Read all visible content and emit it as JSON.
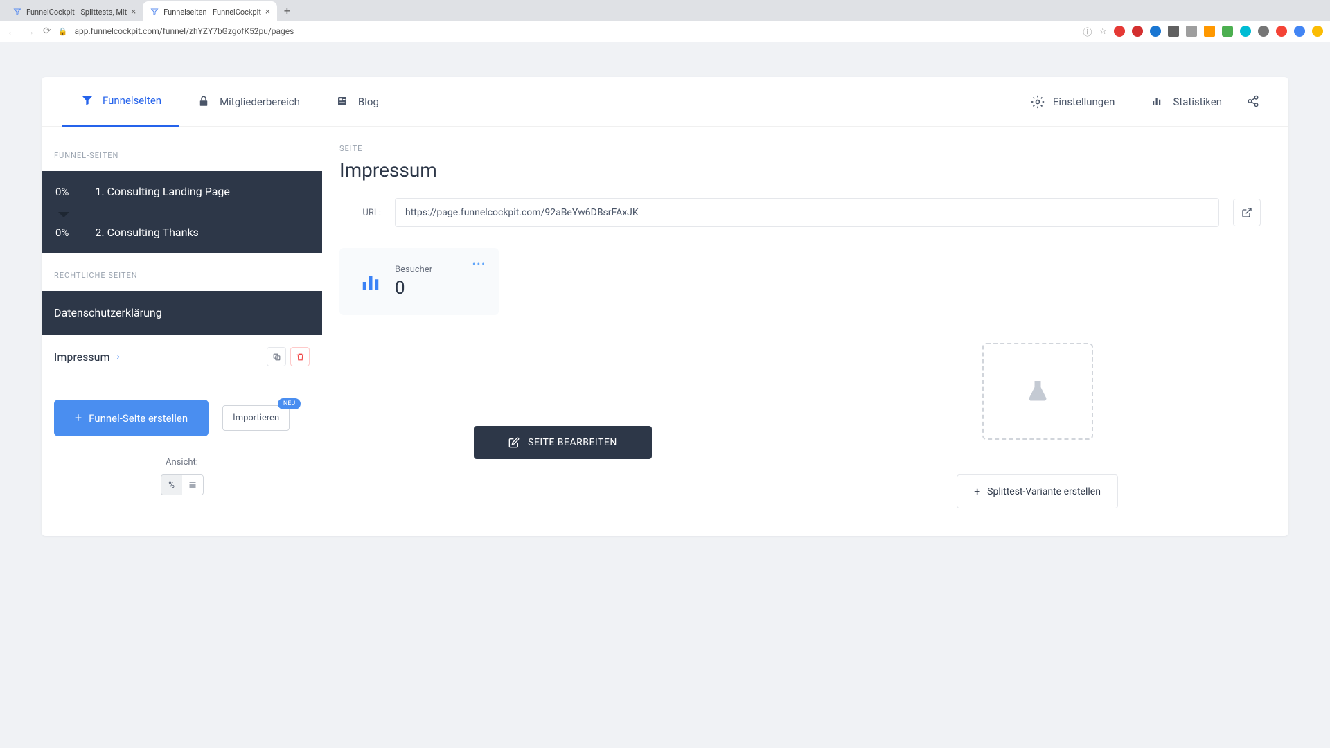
{
  "browser": {
    "tabs": [
      {
        "title": "FunnelCockpit - Splittests, Mit",
        "active": false
      },
      {
        "title": "Funnelseiten - FunnelCockpit",
        "active": true
      }
    ],
    "url": "app.funnelcockpit.com/funnel/zhYZY7bGzgofK52pu/pages"
  },
  "nav": {
    "items": [
      {
        "label": "Funnelseiten",
        "active": true
      },
      {
        "label": "Mitgliederbereich",
        "active": false
      },
      {
        "label": "Blog",
        "active": false
      }
    ],
    "right": [
      {
        "label": "Einstellungen"
      },
      {
        "label": "Statistiken"
      }
    ]
  },
  "sidebar": {
    "section1_label": "FUNNEL-SEITEN",
    "funnel_pages": [
      {
        "pct": "0%",
        "label": "1. Consulting Landing Page"
      },
      {
        "pct": "0%",
        "label": "2. Consulting Thanks"
      }
    ],
    "section2_label": "RECHTLICHE SEITEN",
    "legal_pages": [
      {
        "label": "Datenschutzerklärung",
        "selected": false
      },
      {
        "label": "Impressum",
        "selected": true
      }
    ],
    "create_btn": "Funnel-Seite erstellen",
    "import_btn": "Importieren",
    "neu_badge": "NEU",
    "view_label": "Ansicht:"
  },
  "content": {
    "crumb": "SEITE",
    "title": "Impressum",
    "url_label": "URL:",
    "url_value": "https://page.funnelcockpit.com/92aBeYw6DBsrFAxJK",
    "stat_label": "Besucher",
    "stat_value": "0",
    "edit_btn": "SEITE BEARBEITEN",
    "split_btn": "Splittest-Variante erstellen"
  }
}
